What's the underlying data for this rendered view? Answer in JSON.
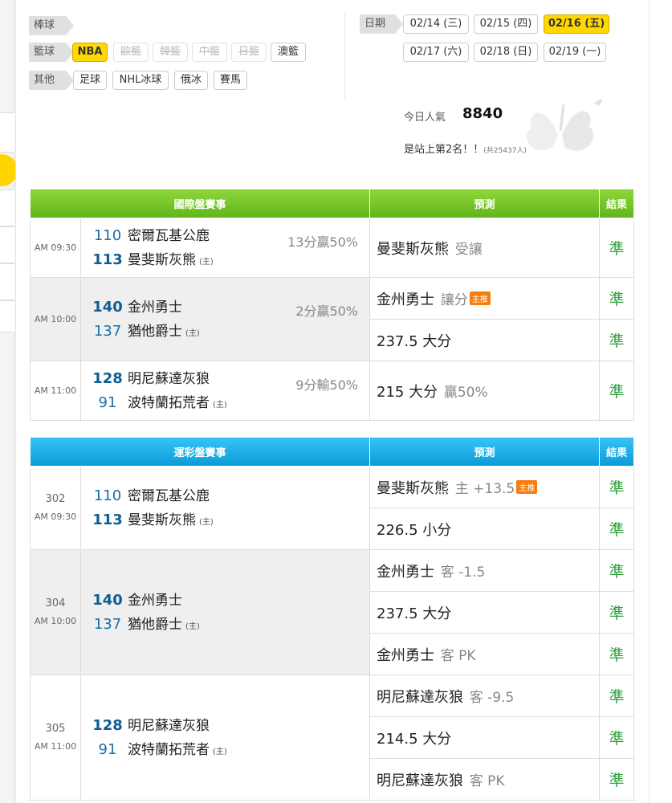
{
  "filters": {
    "baseball_label": "棒球",
    "basketball_label": "籃球",
    "other_label": "其他",
    "basketball": [
      {
        "label": "NBA",
        "state": "active"
      },
      {
        "label": "歐籃",
        "state": "disabled"
      },
      {
        "label": "韓籃",
        "state": "disabled"
      },
      {
        "label": "中籃",
        "state": "disabled"
      },
      {
        "label": "日籃",
        "state": "disabled"
      },
      {
        "label": "澳籃",
        "state": "normal"
      }
    ],
    "other": [
      {
        "label": "足球"
      },
      {
        "label": "NHL冰球"
      },
      {
        "label": "俄冰"
      },
      {
        "label": "賽馬"
      }
    ]
  },
  "dates": {
    "label": "日期",
    "items": [
      {
        "label": "02/14 (三)",
        "active": false
      },
      {
        "label": "02/15 (四)",
        "active": false
      },
      {
        "label": "02/16 (五)",
        "active": true
      },
      {
        "label": "02/17 (六)",
        "active": false
      },
      {
        "label": "02/18 (日)",
        "active": false
      },
      {
        "label": "02/19 (一)",
        "active": false
      }
    ]
  },
  "popularity": {
    "label": "今日人氣",
    "value": "8840",
    "rank_text": "是站上第2名！！",
    "rank_note": "(共25437人)"
  },
  "intl": {
    "headers": {
      "event": "國際盤賽事",
      "predict": "預測",
      "result": "結果"
    },
    "games": [
      {
        "time": "AM 09:30",
        "away": {
          "score": "110",
          "name": "密爾瓦基公鹿"
        },
        "home": {
          "score": "113",
          "name": "曼斐斯灰熊",
          "tag": "(主)"
        },
        "note": "13分贏50%",
        "preds": [
          {
            "main": "曼斐斯灰熊",
            "sub": "受讓",
            "badge": "",
            "result": "準"
          }
        ]
      },
      {
        "time": "AM 10:00",
        "away": {
          "score": "140",
          "name": "金州勇士"
        },
        "home": {
          "score": "137",
          "name": "猶他爵士",
          "tag": "(主)"
        },
        "note": "2分贏50%",
        "preds": [
          {
            "main": "金州勇士",
            "sub": "讓分",
            "badge": "主推",
            "result": "準"
          },
          {
            "main": "237.5 大分",
            "sub": "",
            "badge": "",
            "result": "準"
          }
        ]
      },
      {
        "time": "AM 11:00",
        "away": {
          "score": "128",
          "name": "明尼蘇達灰狼"
        },
        "home": {
          "score": "91",
          "name": "波特蘭拓荒者",
          "tag": "(主)"
        },
        "note": "9分輸50%",
        "preds": [
          {
            "main": "215 大分",
            "sub": "贏50%",
            "badge": "",
            "result": "準"
          }
        ]
      }
    ]
  },
  "sports": {
    "headers": {
      "event": "運彩盤賽事",
      "predict": "預測",
      "result": "結果"
    },
    "games": [
      {
        "num": "302",
        "time": "AM 09:30",
        "away": {
          "score": "110",
          "name": "密爾瓦基公鹿"
        },
        "home": {
          "score": "113",
          "name": "曼斐斯灰熊",
          "tag": "(主)"
        },
        "preds": [
          {
            "main": "曼斐斯灰熊",
            "sub": "主 +13.5",
            "badge": "主推",
            "result": "準"
          },
          {
            "main": "226.5 小分",
            "sub": "",
            "badge": "",
            "result": "準"
          }
        ]
      },
      {
        "num": "304",
        "time": "AM 10:00",
        "away": {
          "score": "140",
          "name": "金州勇士"
        },
        "home": {
          "score": "137",
          "name": "猶他爵士",
          "tag": "(主)"
        },
        "preds": [
          {
            "main": "金州勇士",
            "sub": "客 -1.5",
            "badge": "",
            "result": "準"
          },
          {
            "main": "237.5 大分",
            "sub": "",
            "badge": "",
            "result": "準"
          },
          {
            "main": "金州勇士",
            "sub": "客 PK",
            "badge": "",
            "result": "準"
          }
        ]
      },
      {
        "num": "305",
        "time": "AM 11:00",
        "away": {
          "score": "128",
          "name": "明尼蘇達灰狼"
        },
        "home": {
          "score": "91",
          "name": "波特蘭拓荒者",
          "tag": "(主)"
        },
        "preds": [
          {
            "main": "明尼蘇達灰狼",
            "sub": "客 -9.5",
            "badge": "",
            "result": "準"
          },
          {
            "main": "214.5 大分",
            "sub": "",
            "badge": "",
            "result": "準"
          },
          {
            "main": "明尼蘇達灰狼",
            "sub": "客 PK",
            "badge": "",
            "result": "準"
          }
        ]
      }
    ]
  }
}
